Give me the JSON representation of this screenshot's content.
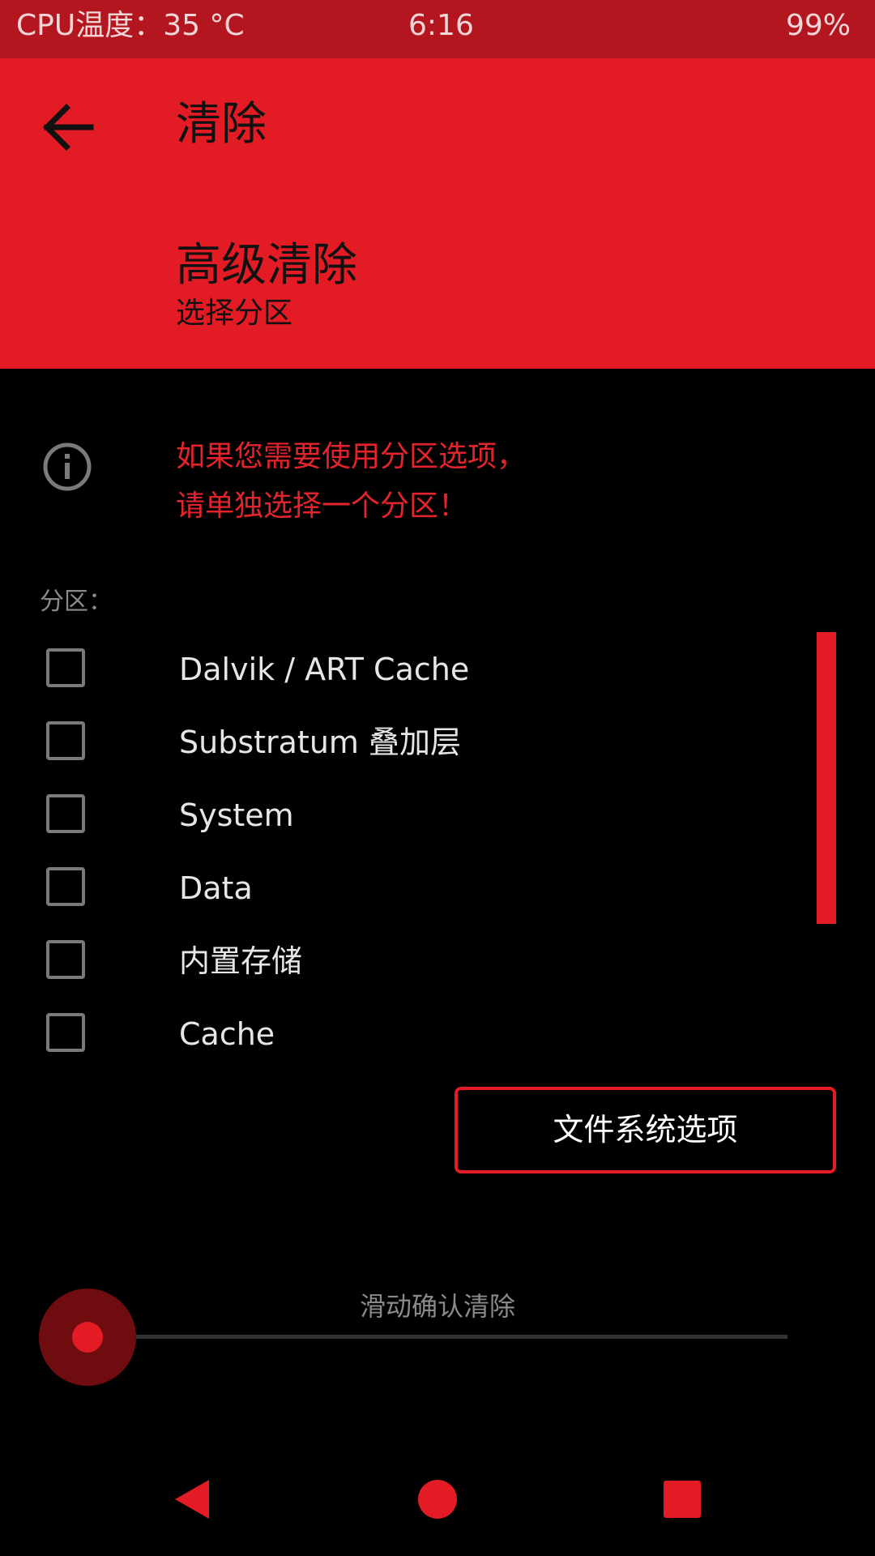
{
  "status_bar": {
    "cpu_temp": "CPU温度：35 °C",
    "time": "6:16",
    "battery": "99%"
  },
  "header": {
    "back_icon": "arrow-left-icon",
    "title": "清除",
    "subtitle": "高级清除",
    "caption": "选择分区"
  },
  "info": {
    "icon": "info-icon",
    "line1": "如果您需要使用分区选项，",
    "line2": "请单独选择一个分区！"
  },
  "partitions": {
    "label": "分区：",
    "items": [
      {
        "label": "Dalvik / ART Cache",
        "checked": false
      },
      {
        "label": "Substratum 叠加层",
        "checked": false
      },
      {
        "label": "System",
        "checked": false
      },
      {
        "label": "Data",
        "checked": false
      },
      {
        "label": "内置存储",
        "checked": false
      },
      {
        "label": "Cache",
        "checked": false
      }
    ]
  },
  "fs_button_label": "文件系统选项",
  "swipe": {
    "label": "滑动确认清除"
  },
  "nav": {
    "back": "nav-back-icon",
    "home": "nav-home-icon",
    "recents": "nav-recents-icon"
  },
  "colors": {
    "accent": "#e31b25",
    "status_bar": "#b3161e",
    "background": "#000000"
  }
}
